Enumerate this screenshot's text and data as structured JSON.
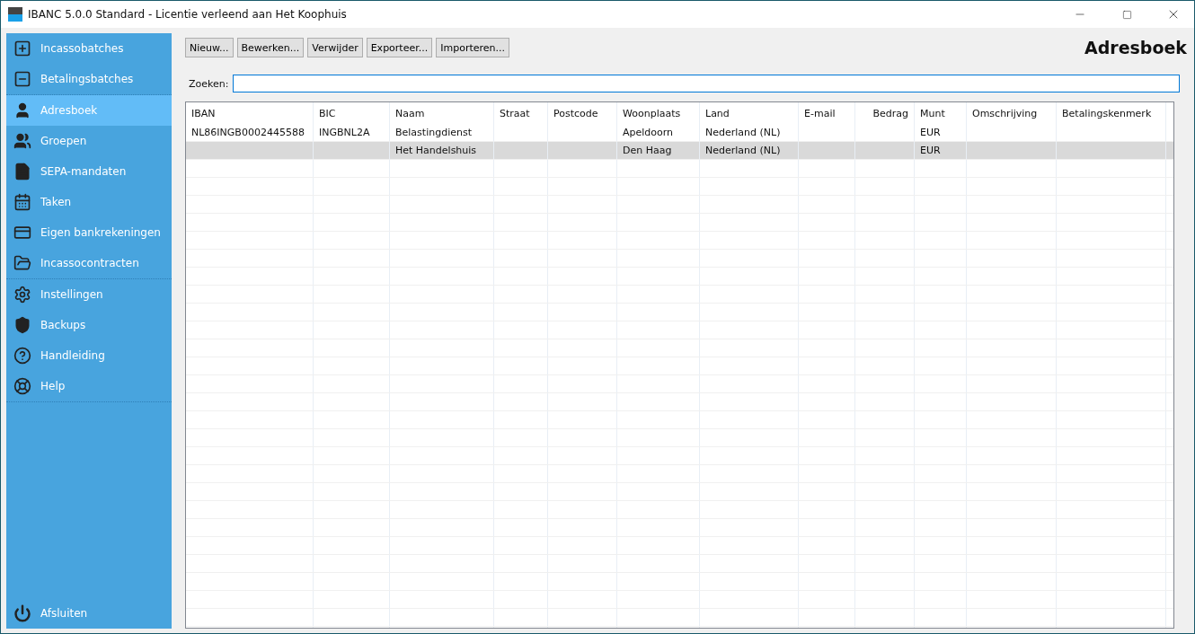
{
  "window": {
    "title": "IBANC 5.0.0 Standard - Licentie verleend aan Het Koophuis"
  },
  "sidebar": {
    "groups": [
      [
        {
          "label": "Incassobatches",
          "selected": false
        },
        {
          "label": "Betalingsbatches",
          "selected": false
        }
      ],
      [
        {
          "label": "Adresboek",
          "selected": true
        },
        {
          "label": "Groepen",
          "selected": false
        },
        {
          "label": "SEPA-mandaten",
          "selected": false
        },
        {
          "label": "Taken",
          "selected": false
        },
        {
          "label": "Eigen bankrekeningen",
          "selected": false
        },
        {
          "label": "Incassocontracten",
          "selected": false
        }
      ],
      [
        {
          "label": "Instellingen",
          "selected": false
        },
        {
          "label": "Backups",
          "selected": false
        },
        {
          "label": "Handleiding",
          "selected": false
        },
        {
          "label": "Help",
          "selected": false
        }
      ]
    ],
    "footer": {
      "label": "Afsluiten"
    }
  },
  "toolbar": {
    "buttons": [
      "Nieuw...",
      "Bewerken...",
      "Verwijder",
      "Exporteer...",
      "Importeren..."
    ]
  },
  "page_title": "Adresboek",
  "search": {
    "label": "Zoeken:"
  },
  "table": {
    "columns": [
      "IBAN",
      "BIC",
      "Naam",
      "Straat",
      "Postcode",
      "Woonplaats",
      "Land",
      "E-mail",
      "Bedrag",
      "Munt",
      "Omschrijving",
      "Betalingskenmerk"
    ],
    "rows": [
      {
        "selected": false,
        "cells": [
          "NL86INGB0002445588",
          "INGBNL2A",
          "Belastingdienst",
          "",
          "",
          "Apeldoorn",
          "Nederland (NL)",
          "",
          "",
          "EUR",
          "",
          ""
        ]
      },
      {
        "selected": true,
        "cells": [
          "",
          "",
          "Het Handelshuis",
          "",
          "",
          "Den Haag",
          "Nederland (NL)",
          "",
          "",
          "EUR",
          "",
          ""
        ]
      }
    ]
  }
}
